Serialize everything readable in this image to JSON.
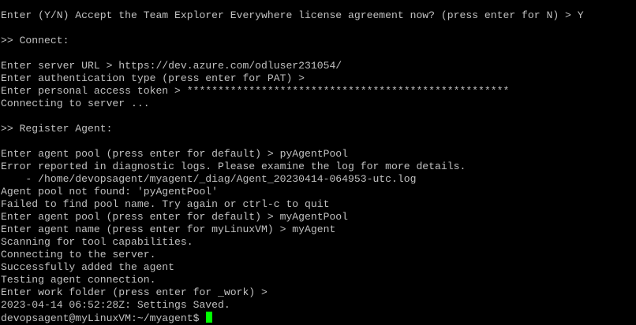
{
  "terminal": {
    "lines": [
      "Enter (Y/N) Accept the Team Explorer Everywhere license agreement now? (press enter for N) > Y",
      "",
      ">> Connect:",
      "",
      "Enter server URL > https://dev.azure.com/odluser231054/",
      "Enter authentication type (press enter for PAT) >",
      "Enter personal access token > ****************************************************",
      "Connecting to server ...",
      "",
      ">> Register Agent:",
      "",
      "Enter agent pool (press enter for default) > pyAgentPool",
      "Error reported in diagnostic logs. Please examine the log for more details.",
      "    - /home/devopsagent/myagent/_diag/Agent_20230414-064953-utc.log",
      "Agent pool not found: 'pyAgentPool'",
      "Failed to find pool name. Try again or ctrl-c to quit",
      "Enter agent pool (press enter for default) > myAgentPool",
      "Enter agent name (press enter for myLinuxVM) > myAgent",
      "Scanning for tool capabilities.",
      "Connecting to the server.",
      "Successfully added the agent",
      "Testing agent connection.",
      "Enter work folder (press enter for _work) >",
      "2023-04-14 06:52:28Z: Settings Saved.",
      "devopsagent@myLinuxVM:~/myagent$"
    ],
    "text_color": "#c0c0c0",
    "background_color": "#000000",
    "cursor_color": "#00ff00"
  }
}
